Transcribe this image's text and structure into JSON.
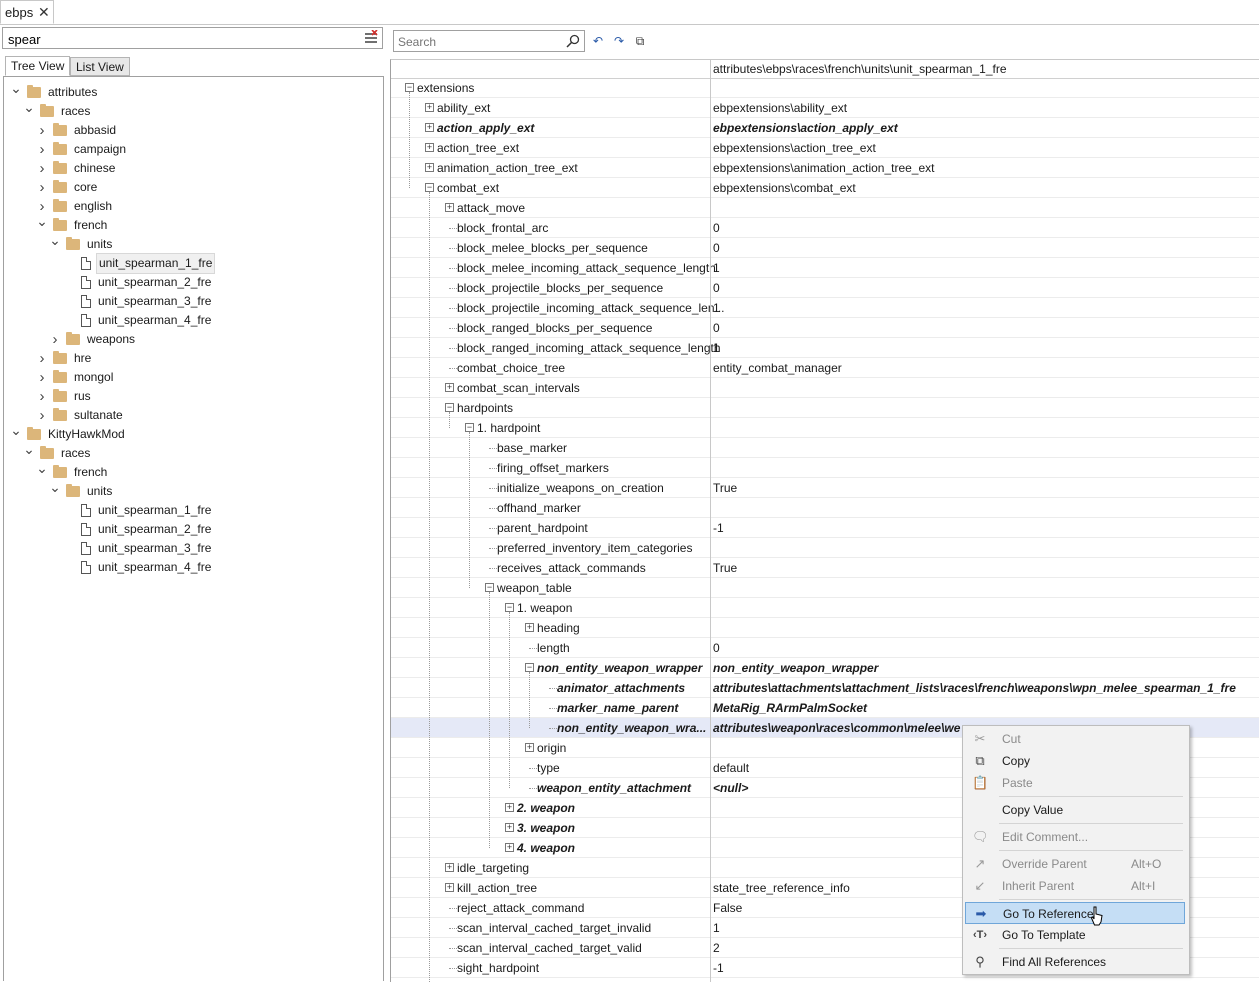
{
  "doc_tab": {
    "label": "ebps"
  },
  "filter": {
    "value": "spear"
  },
  "view_tabs": {
    "tree": "Tree View",
    "list": "List View"
  },
  "tree": [
    {
      "label": "attributes",
      "type": "folder",
      "depth": 0,
      "expanded": true
    },
    {
      "label": "races",
      "type": "folder",
      "depth": 1,
      "expanded": true
    },
    {
      "label": "abbasid",
      "type": "folder",
      "depth": 2,
      "expanded": false
    },
    {
      "label": "campaign",
      "type": "folder",
      "depth": 2,
      "expanded": false
    },
    {
      "label": "chinese",
      "type": "folder",
      "depth": 2,
      "expanded": false
    },
    {
      "label": "core",
      "type": "folder",
      "depth": 2,
      "expanded": false
    },
    {
      "label": "english",
      "type": "folder",
      "depth": 2,
      "expanded": false
    },
    {
      "label": "french",
      "type": "folder",
      "depth": 2,
      "expanded": true
    },
    {
      "label": "units",
      "type": "folder",
      "depth": 3,
      "expanded": true
    },
    {
      "label": "unit_spearman_1_fre",
      "type": "file",
      "depth": 4,
      "selected": true
    },
    {
      "label": "unit_spearman_2_fre",
      "type": "file",
      "depth": 4
    },
    {
      "label": "unit_spearman_3_fre",
      "type": "file",
      "depth": 4
    },
    {
      "label": "unit_spearman_4_fre",
      "type": "file",
      "depth": 4
    },
    {
      "label": "weapons",
      "type": "folder",
      "depth": 3,
      "expanded": false
    },
    {
      "label": "hre",
      "type": "folder",
      "depth": 2,
      "expanded": false
    },
    {
      "label": "mongol",
      "type": "folder",
      "depth": 2,
      "expanded": false
    },
    {
      "label": "rus",
      "type": "folder",
      "depth": 2,
      "expanded": false
    },
    {
      "label": "sultanate",
      "type": "folder",
      "depth": 2,
      "expanded": false
    },
    {
      "label": "KittyHawkMod",
      "type": "folder",
      "depth": 0,
      "expanded": true
    },
    {
      "label": "races",
      "type": "folder",
      "depth": 1,
      "expanded": true
    },
    {
      "label": "french",
      "type": "folder",
      "depth": 2,
      "expanded": true
    },
    {
      "label": "units",
      "type": "folder",
      "depth": 3,
      "expanded": true
    },
    {
      "label": "unit_spearman_1_fre",
      "type": "file",
      "depth": 4
    },
    {
      "label": "unit_spearman_2_fre",
      "type": "file",
      "depth": 4
    },
    {
      "label": "unit_spearman_3_fre",
      "type": "file",
      "depth": 4
    },
    {
      "label": "unit_spearman_4_fre",
      "type": "file",
      "depth": 4
    }
  ],
  "search": {
    "placeholder": "Search"
  },
  "grid_header": {
    "path": "attributes\\ebps\\races\\french\\units\\unit_spearman_1_fre"
  },
  "rows": [
    {
      "name": "extensions",
      "value": "",
      "depth": 0,
      "node": "minus",
      "bold": false
    },
    {
      "name": "ability_ext",
      "value": "ebpextensions\\ability_ext",
      "depth": 1,
      "node": "plus",
      "bold": false
    },
    {
      "name": "action_apply_ext",
      "value": "ebpextensions\\action_apply_ext",
      "depth": 1,
      "node": "plus",
      "bold": true
    },
    {
      "name": "action_tree_ext",
      "value": "ebpextensions\\action_tree_ext",
      "depth": 1,
      "node": "plus",
      "bold": false
    },
    {
      "name": "animation_action_tree_ext",
      "value": "ebpextensions\\animation_action_tree_ext",
      "depth": 1,
      "node": "plus",
      "bold": false
    },
    {
      "name": "combat_ext",
      "value": "ebpextensions\\combat_ext",
      "depth": 1,
      "node": "minus",
      "bold": false
    },
    {
      "name": "attack_move",
      "value": "",
      "depth": 2,
      "node": "plus",
      "bold": false
    },
    {
      "name": "block_frontal_arc",
      "value": "0",
      "depth": 2,
      "node": "leaf",
      "bold": false
    },
    {
      "name": "block_melee_blocks_per_sequence",
      "value": "0",
      "depth": 2,
      "node": "leaf",
      "bold": false
    },
    {
      "name": "block_melee_incoming_attack_sequence_length",
      "value": "1",
      "depth": 2,
      "node": "leaf",
      "bold": false
    },
    {
      "name": "block_projectile_blocks_per_sequence",
      "value": "0",
      "depth": 2,
      "node": "leaf",
      "bold": false
    },
    {
      "name": "block_projectile_incoming_attack_sequence_len...",
      "value": "1",
      "depth": 2,
      "node": "leaf",
      "bold": false
    },
    {
      "name": "block_ranged_blocks_per_sequence",
      "value": "0",
      "depth": 2,
      "node": "leaf",
      "bold": false
    },
    {
      "name": "block_ranged_incoming_attack_sequence_length",
      "value": "1",
      "depth": 2,
      "node": "leaf",
      "bold": false
    },
    {
      "name": "combat_choice_tree",
      "value": "entity_combat_manager",
      "depth": 2,
      "node": "leaf",
      "bold": false
    },
    {
      "name": "combat_scan_intervals",
      "value": "",
      "depth": 2,
      "node": "plus",
      "bold": false
    },
    {
      "name": "hardpoints",
      "value": "",
      "depth": 2,
      "node": "minus",
      "bold": false
    },
    {
      "name": "1. hardpoint",
      "value": "",
      "depth": 3,
      "node": "minus",
      "bold": false
    },
    {
      "name": "base_marker",
      "value": "",
      "depth": 4,
      "node": "leaf",
      "bold": false
    },
    {
      "name": "firing_offset_markers",
      "value": "",
      "depth": 4,
      "node": "leaf",
      "bold": false
    },
    {
      "name": "initialize_weapons_on_creation",
      "value": "True",
      "depth": 4,
      "node": "leaf",
      "bold": false
    },
    {
      "name": "offhand_marker",
      "value": "",
      "depth": 4,
      "node": "leaf",
      "bold": false
    },
    {
      "name": "parent_hardpoint",
      "value": "-1",
      "depth": 4,
      "node": "leaf",
      "bold": false
    },
    {
      "name": "preferred_inventory_item_categories",
      "value": "",
      "depth": 4,
      "node": "leaf",
      "bold": false
    },
    {
      "name": "receives_attack_commands",
      "value": "True",
      "depth": 4,
      "node": "leaf",
      "bold": false
    },
    {
      "name": "weapon_table",
      "value": "",
      "depth": 4,
      "node": "minus",
      "bold": false
    },
    {
      "name": "1. weapon",
      "value": "",
      "depth": 5,
      "node": "minus",
      "bold": false
    },
    {
      "name": "heading",
      "value": "",
      "depth": 6,
      "node": "plus",
      "bold": false
    },
    {
      "name": "length",
      "value": "0",
      "depth": 6,
      "node": "leaf",
      "bold": false
    },
    {
      "name": "non_entity_weapon_wrapper",
      "value": "non_entity_weapon_wrapper",
      "depth": 6,
      "node": "minus",
      "bold": true
    },
    {
      "name": "animator_attachments",
      "value": "attributes\\attachments\\attachment_lists\\races\\french\\weapons\\wpn_melee_spearman_1_fre",
      "depth": 7,
      "node": "leaf",
      "bold": true
    },
    {
      "name": "marker_name_parent",
      "value": "MetaRig_RArmPalmSocket",
      "depth": 7,
      "node": "leaf",
      "bold": true
    },
    {
      "name": "non_entity_weapon_wra...",
      "value": "attributes\\weapon\\races\\common\\melee\\we",
      "depth": 7,
      "node": "leaf",
      "bold": true,
      "highlight": true
    },
    {
      "name": "origin",
      "value": "",
      "depth": 6,
      "node": "plus",
      "bold": false
    },
    {
      "name": "type",
      "value": "default",
      "depth": 6,
      "node": "leaf",
      "bold": false
    },
    {
      "name": "weapon_entity_attachment",
      "value": "<null>",
      "depth": 6,
      "node": "leaf",
      "bold": true
    },
    {
      "name": "2. weapon",
      "value": "",
      "depth": 5,
      "node": "plus",
      "bold": true
    },
    {
      "name": "3. weapon",
      "value": "",
      "depth": 5,
      "node": "plus",
      "bold": true
    },
    {
      "name": "4. weapon",
      "value": "",
      "depth": 5,
      "node": "plus",
      "bold": true
    },
    {
      "name": "idle_targeting",
      "value": "",
      "depth": 2,
      "node": "plus",
      "bold": false
    },
    {
      "name": "kill_action_tree",
      "value": "state_tree_reference_info",
      "depth": 2,
      "node": "plus",
      "bold": false
    },
    {
      "name": "reject_attack_command",
      "value": "False",
      "depth": 2,
      "node": "leaf",
      "bold": false
    },
    {
      "name": "scan_interval_cached_target_invalid",
      "value": "1",
      "depth": 2,
      "node": "leaf",
      "bold": false
    },
    {
      "name": "scan_interval_cached_target_valid",
      "value": "2",
      "depth": 2,
      "node": "leaf",
      "bold": false
    },
    {
      "name": "sight_hardpoint",
      "value": "-1",
      "depth": 2,
      "node": "leaf",
      "bold": false
    }
  ],
  "context_menu": [
    {
      "label": "Cut",
      "icon": "cut-icon",
      "glyph": "✂",
      "disabled": true
    },
    {
      "label": "Copy",
      "icon": "copy-icon",
      "glyph": "⧉",
      "disabled": false
    },
    {
      "label": "Paste",
      "icon": "paste-icon",
      "glyph": "📋",
      "disabled": true
    },
    {
      "sep": true
    },
    {
      "label": "Copy Value",
      "icon": "",
      "glyph": "",
      "disabled": false
    },
    {
      "sep": true
    },
    {
      "label": "Edit Comment...",
      "icon": "comment-icon",
      "glyph": "🗨",
      "disabled": true
    },
    {
      "sep": true
    },
    {
      "label": "Override Parent",
      "shortcut": "Alt+O",
      "icon": "override-parent-icon",
      "glyph": "↗",
      "disabled": true
    },
    {
      "label": "Inherit Parent",
      "shortcut": "Alt+I",
      "icon": "inherit-parent-icon",
      "glyph": "↙",
      "disabled": true
    },
    {
      "sep": true
    },
    {
      "label": "Go To Reference",
      "icon": "go-to-reference-icon",
      "glyph": "➡",
      "disabled": false,
      "active": true
    },
    {
      "label": "Go To Template",
      "icon": "go-to-template-icon",
      "glyph": "‹T›",
      "disabled": false
    },
    {
      "sep": true
    },
    {
      "label": "Find All References",
      "icon": "find-icon",
      "glyph": "⚲",
      "disabled": false
    }
  ]
}
